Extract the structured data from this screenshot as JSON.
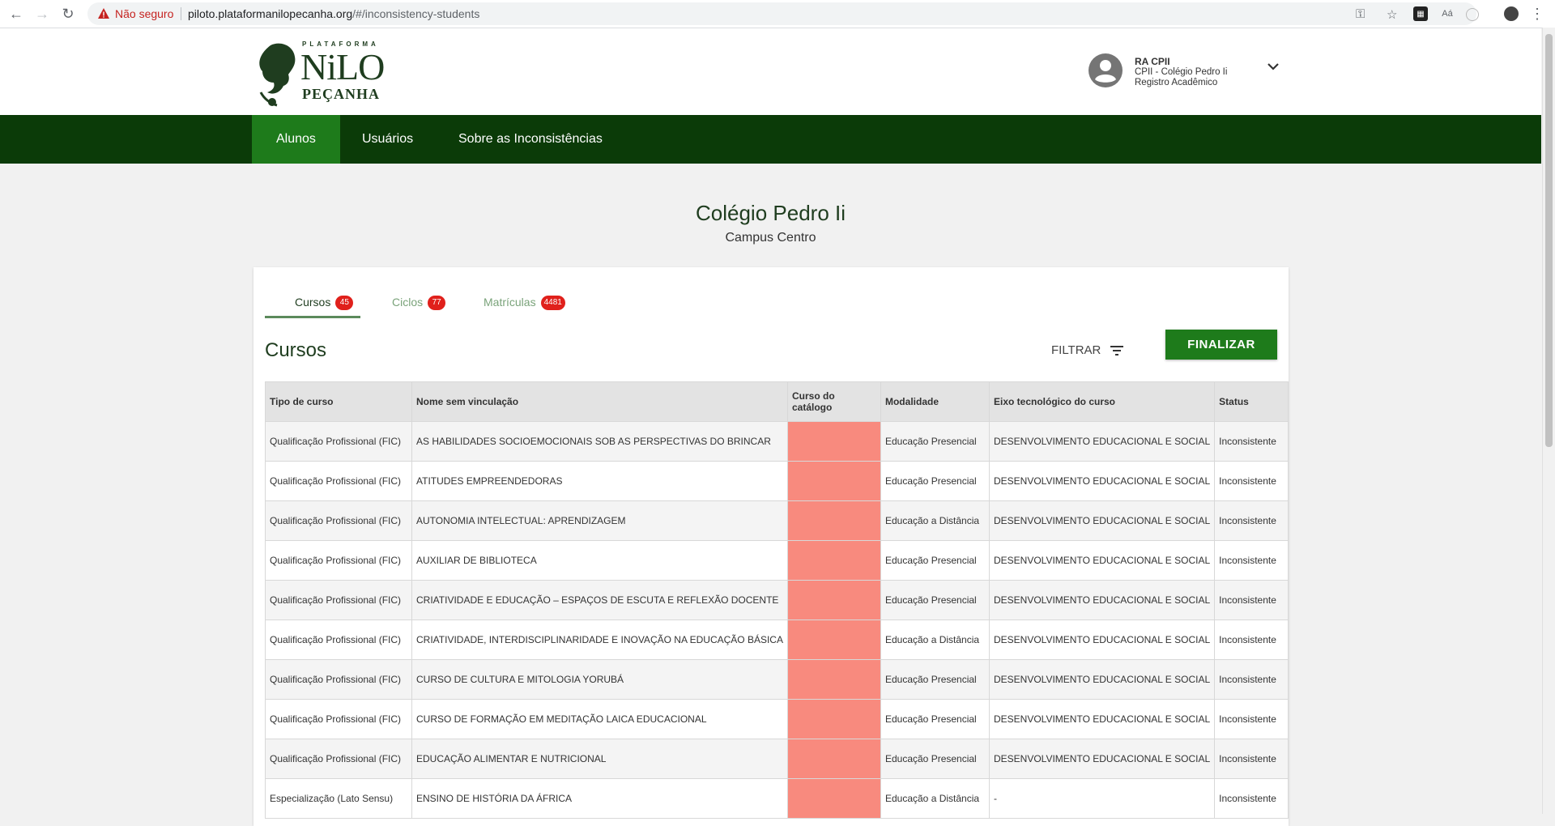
{
  "browser": {
    "insecure_label": "Não seguro",
    "url_host": "piloto.plataformanilopecanha.org",
    "url_path": "/#/inconsistency-students"
  },
  "logo": {
    "top_text": "PLATAFORMA",
    "main_text": "NiLO",
    "bottom_text": "PEÇANHA"
  },
  "user": {
    "name": "RA CPII",
    "line1": "CPII - Colégio Pedro Ii",
    "line2": "Registro Acadêmico"
  },
  "nav": {
    "items": [
      {
        "label": "Alunos"
      },
      {
        "label": "Usuários"
      },
      {
        "label": "Sobre as Inconsistências"
      }
    ]
  },
  "school": {
    "name": "Colégio Pedro Ii",
    "campus": "Campus Centro"
  },
  "tabs": [
    {
      "label": "Cursos",
      "count": "45"
    },
    {
      "label": "Ciclos",
      "count": "77"
    },
    {
      "label": "Matrículas",
      "count": "4481"
    }
  ],
  "section": {
    "title": "Cursos",
    "filter_label": "FILTRAR",
    "finalize_label": "FINALIZAR"
  },
  "table": {
    "headers": [
      "Tipo de curso",
      "Nome sem vinculação",
      "Curso do catálogo",
      "Modalidade",
      "Eixo tecnológico do curso",
      "Status"
    ],
    "rows": [
      [
        "Qualificação Profissional (FIC)",
        "AS HABILIDADES SOCIOEMOCIONAIS SOB AS PERSPECTIVAS DO BRINCAR",
        "",
        "Educação Presencial",
        "DESENVOLVIMENTO EDUCACIONAL E SOCIAL",
        "Inconsistente"
      ],
      [
        "Qualificação Profissional (FIC)",
        "ATITUDES EMPREENDEDORAS",
        "",
        "Educação Presencial",
        "DESENVOLVIMENTO EDUCACIONAL E SOCIAL",
        "Inconsistente"
      ],
      [
        "Qualificação Profissional (FIC)",
        "AUTONOMIA INTELECTUAL: APRENDIZAGEM",
        "",
        "Educação a Distância",
        "DESENVOLVIMENTO EDUCACIONAL E SOCIAL",
        "Inconsistente"
      ],
      [
        "Qualificação Profissional (FIC)",
        "AUXILIAR DE BIBLIOTECA",
        "",
        "Educação Presencial",
        "DESENVOLVIMENTO EDUCACIONAL E SOCIAL",
        "Inconsistente"
      ],
      [
        "Qualificação Profissional (FIC)",
        "CRIATIVIDADE E EDUCAÇÃO – ESPAÇOS DE ESCUTA E REFLEXÃO DOCENTE",
        "",
        "Educação Presencial",
        "DESENVOLVIMENTO EDUCACIONAL E SOCIAL",
        "Inconsistente"
      ],
      [
        "Qualificação Profissional (FIC)",
        "CRIATIVIDADE, INTERDISCIPLINARIDADE E INOVAÇÃO NA EDUCAÇÃO BÁSICA",
        "",
        "Educação a Distância",
        "DESENVOLVIMENTO EDUCACIONAL E SOCIAL",
        "Inconsistente"
      ],
      [
        "Qualificação Profissional (FIC)",
        "CURSO DE CULTURA E MITOLOGIA YORUBÁ",
        "",
        "Educação Presencial",
        "DESENVOLVIMENTO EDUCACIONAL E SOCIAL",
        "Inconsistente"
      ],
      [
        "Qualificação Profissional (FIC)",
        "CURSO DE FORMAÇÃO EM MEDITAÇÃO LAICA EDUCACIONAL",
        "",
        "Educação Presencial",
        "DESENVOLVIMENTO EDUCACIONAL E SOCIAL",
        "Inconsistente"
      ],
      [
        "Qualificação Profissional (FIC)",
        "EDUCAÇÃO ALIMENTAR E NUTRICIONAL",
        "",
        "Educação Presencial",
        "DESENVOLVIMENTO EDUCACIONAL E SOCIAL",
        "Inconsistente"
      ],
      [
        "Especialização (Lato Sensu)",
        "ENSINO DE HISTÓRIA DA ÁFRICA",
        "",
        "Educação a Distância",
        "-",
        "Inconsistente"
      ]
    ]
  },
  "colors": {
    "nav_bg": "#0b3b08",
    "nav_active": "#1e7b1b",
    "badge": "#e0201b",
    "catalog_missing": "#f88a7e"
  }
}
